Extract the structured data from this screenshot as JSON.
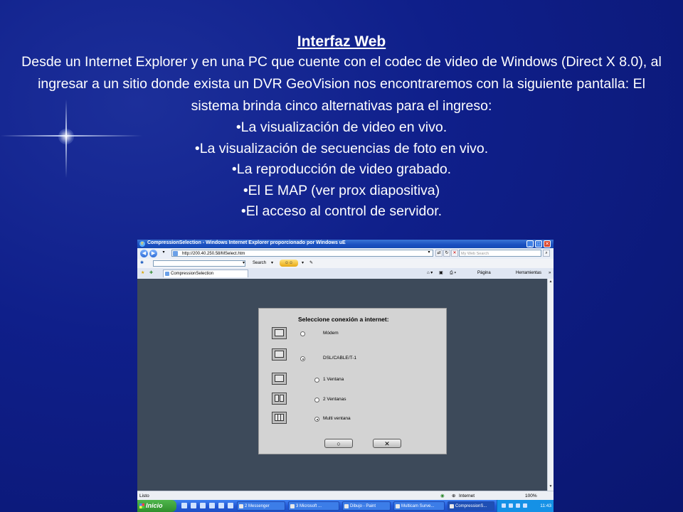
{
  "slide": {
    "title": "Interfaz Web",
    "paragraph": "Desde un Internet Explorer y en una PC que cuente con el codec de video de Windows (Direct X 8.0), al ingresar a un sitio donde exista un DVR GeoVision nos encontraremos con la siguiente pantalla: El sistema brinda cinco alternativas para el ingreso:",
    "bullets": [
      "•La visualización de video en vivo.",
      "•La visualización de secuencias de foto en vivo.",
      "•La reproducción de video grabado.",
      "•El E MAP (ver prox diapositiva)",
      "•El acceso al control de servidor."
    ]
  },
  "browser": {
    "window_title": "CompressionSelection - Windows Internet Explorer proporcionado por Windows uE",
    "address": "http://200.40.250.58/MSelect.htm",
    "search_placeholder": "My Web Search",
    "toolbar_search_label": "Search",
    "tab_label": "CompressionSelection",
    "page_menu": "Página",
    "tools_menu": "Herramientas",
    "status_text": "Listo",
    "zone": "Internet",
    "zoom": "100%"
  },
  "dialog": {
    "title": "Seleccione conexión a internet:",
    "options": [
      {
        "label": "Módem",
        "selected": false
      },
      {
        "label": "DSL/CABLE/T-1",
        "selected": true
      },
      {
        "label": "1 Ventana",
        "selected": false
      },
      {
        "label": "2 Ventanas",
        "selected": false
      },
      {
        "label": "Multi ventana",
        "selected": true
      }
    ],
    "ok_symbol": "○",
    "cancel_symbol": "✕"
  },
  "taskbar": {
    "start_label": "Inicio",
    "tasks": [
      "2 Messenger",
      "3 Microsoft ...",
      "Dibujo - Paint",
      "Multicam Surve...",
      "CompressionS..."
    ],
    "clock": "11:43"
  }
}
